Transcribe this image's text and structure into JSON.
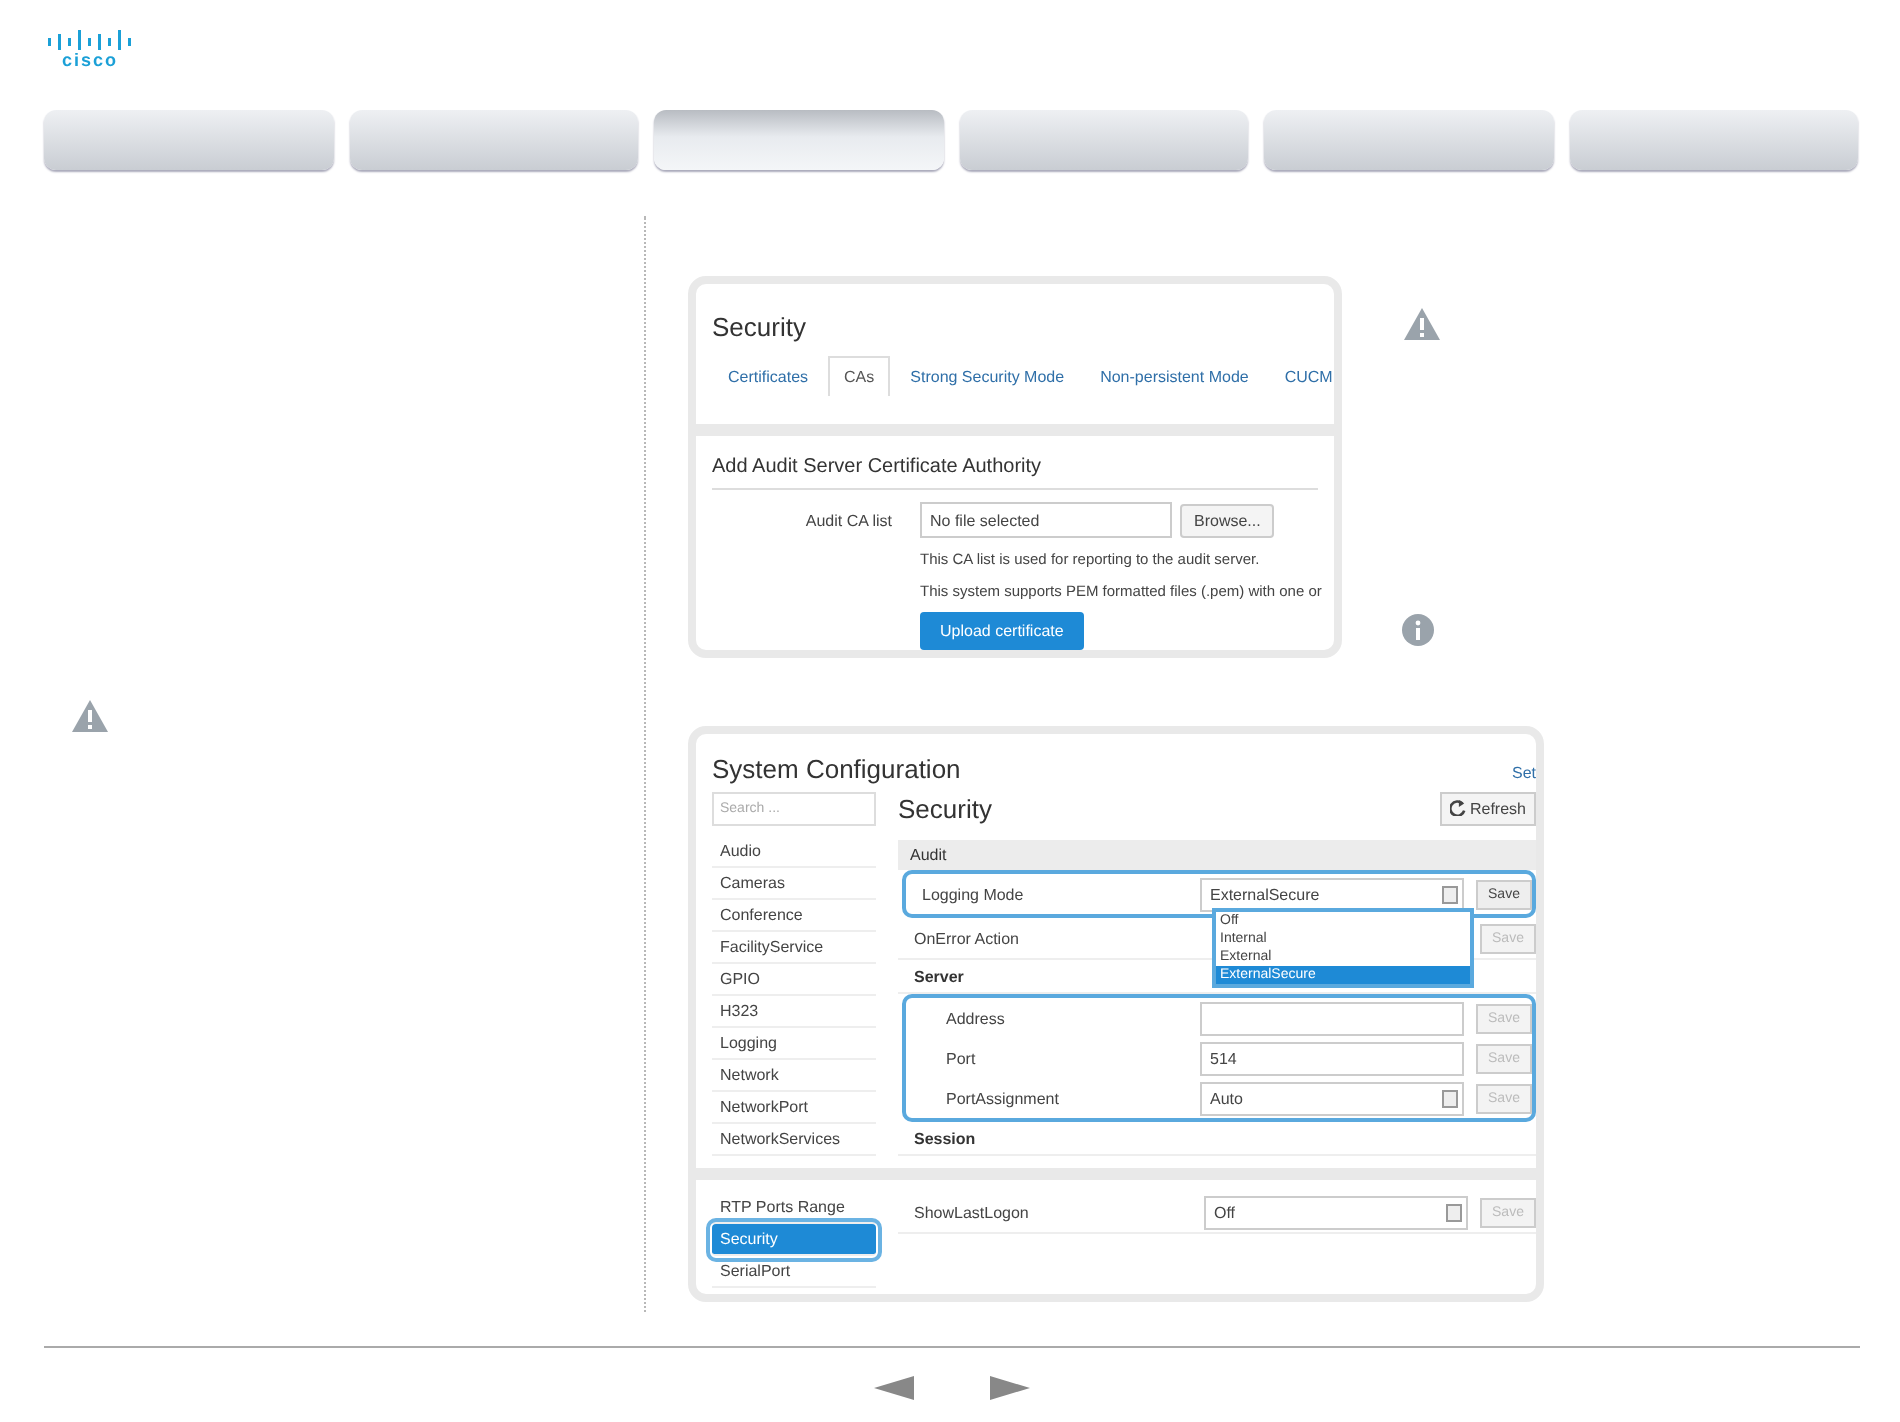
{
  "logo": "cisco",
  "nav_tabs": [
    {
      "selected": false
    },
    {
      "selected": false
    },
    {
      "selected": true
    },
    {
      "selected": false
    },
    {
      "selected": false
    },
    {
      "selected": false
    }
  ],
  "security_panel": {
    "title": "Security",
    "tabs": [
      {
        "label": "Certificates",
        "selected": false
      },
      {
        "label": "CAs",
        "selected": true
      },
      {
        "label": "Strong Security Mode",
        "selected": false
      },
      {
        "label": "Non-persistent Mode",
        "selected": false
      },
      {
        "label": "CUCM",
        "selected": false
      }
    ],
    "section_title": "Add Audit Server Certificate Authority",
    "field_label": "Audit CA list",
    "file_value": "No file selected",
    "browse_button": "Browse...",
    "notes": [
      "This CA list is used for reporting to the audit server.",
      "This system supports PEM formatted files (.pem) with one or"
    ],
    "upload_button": "Upload certificate"
  },
  "config_panel": {
    "title": "System Configuration",
    "header_link": "Set",
    "search": {
      "placeholder": "Search ..."
    },
    "heading": "Security",
    "refresh_button": "Refresh",
    "section_title": "Audit",
    "parts": [
      {
        "sidebar": [
          {
            "label": "Audio",
            "selected": false
          },
          {
            "label": "Cameras",
            "selected": false
          },
          {
            "label": "Conference",
            "selected": false
          },
          {
            "label": "FacilityService",
            "selected": false
          },
          {
            "label": "GPIO",
            "selected": false
          },
          {
            "label": "H323",
            "selected": false
          },
          {
            "label": "Logging",
            "selected": false
          },
          {
            "label": "Network",
            "selected": false
          },
          {
            "label": "NetworkPort",
            "selected": false
          },
          {
            "label": "NetworkServices",
            "selected": false
          }
        ],
        "rows": [
          {
            "kind": "select",
            "label": "Logging Mode",
            "value": "ExternalSecure",
            "save": "Save",
            "save_disabled": false,
            "highlighted": true,
            "options": [
              {
                "label": "Off",
                "selected": false
              },
              {
                "label": "Internal",
                "selected": false
              },
              {
                "label": "External",
                "selected": false
              },
              {
                "label": "ExternalSecure",
                "selected": true
              }
            ]
          },
          {
            "kind": "select",
            "label": "OnError Action",
            "save": "Save",
            "save_disabled": true,
            "highlighted": false
          },
          {
            "kind": "subheading",
            "label": "Server",
            "children": [
              {
                "kind": "text",
                "label": "Address",
                "save": "Save",
                "save_disabled": true,
                "highlighted": true
              },
              {
                "kind": "text",
                "label": "Port",
                "value": "514",
                "save": "Save",
                "save_disabled": true,
                "highlighted": true
              },
              {
                "kind": "select",
                "label": "PortAssignment",
                "value": "Auto",
                "save": "Save",
                "save_disabled": true,
                "highlighted": true
              }
            ]
          },
          {
            "kind": "subheading",
            "label": "Session"
          }
        ]
      },
      {
        "sidebar": [
          {
            "label": "RTP Ports Range",
            "selected": false
          },
          {
            "label": "Security",
            "selected": true
          },
          {
            "label": "SerialPort",
            "selected": false
          }
        ],
        "rows": [
          {
            "kind": "select",
            "label": "ShowLastLogon",
            "value": "Off",
            "save": "Save",
            "save_disabled": true,
            "highlighted": false
          }
        ]
      }
    ]
  }
}
